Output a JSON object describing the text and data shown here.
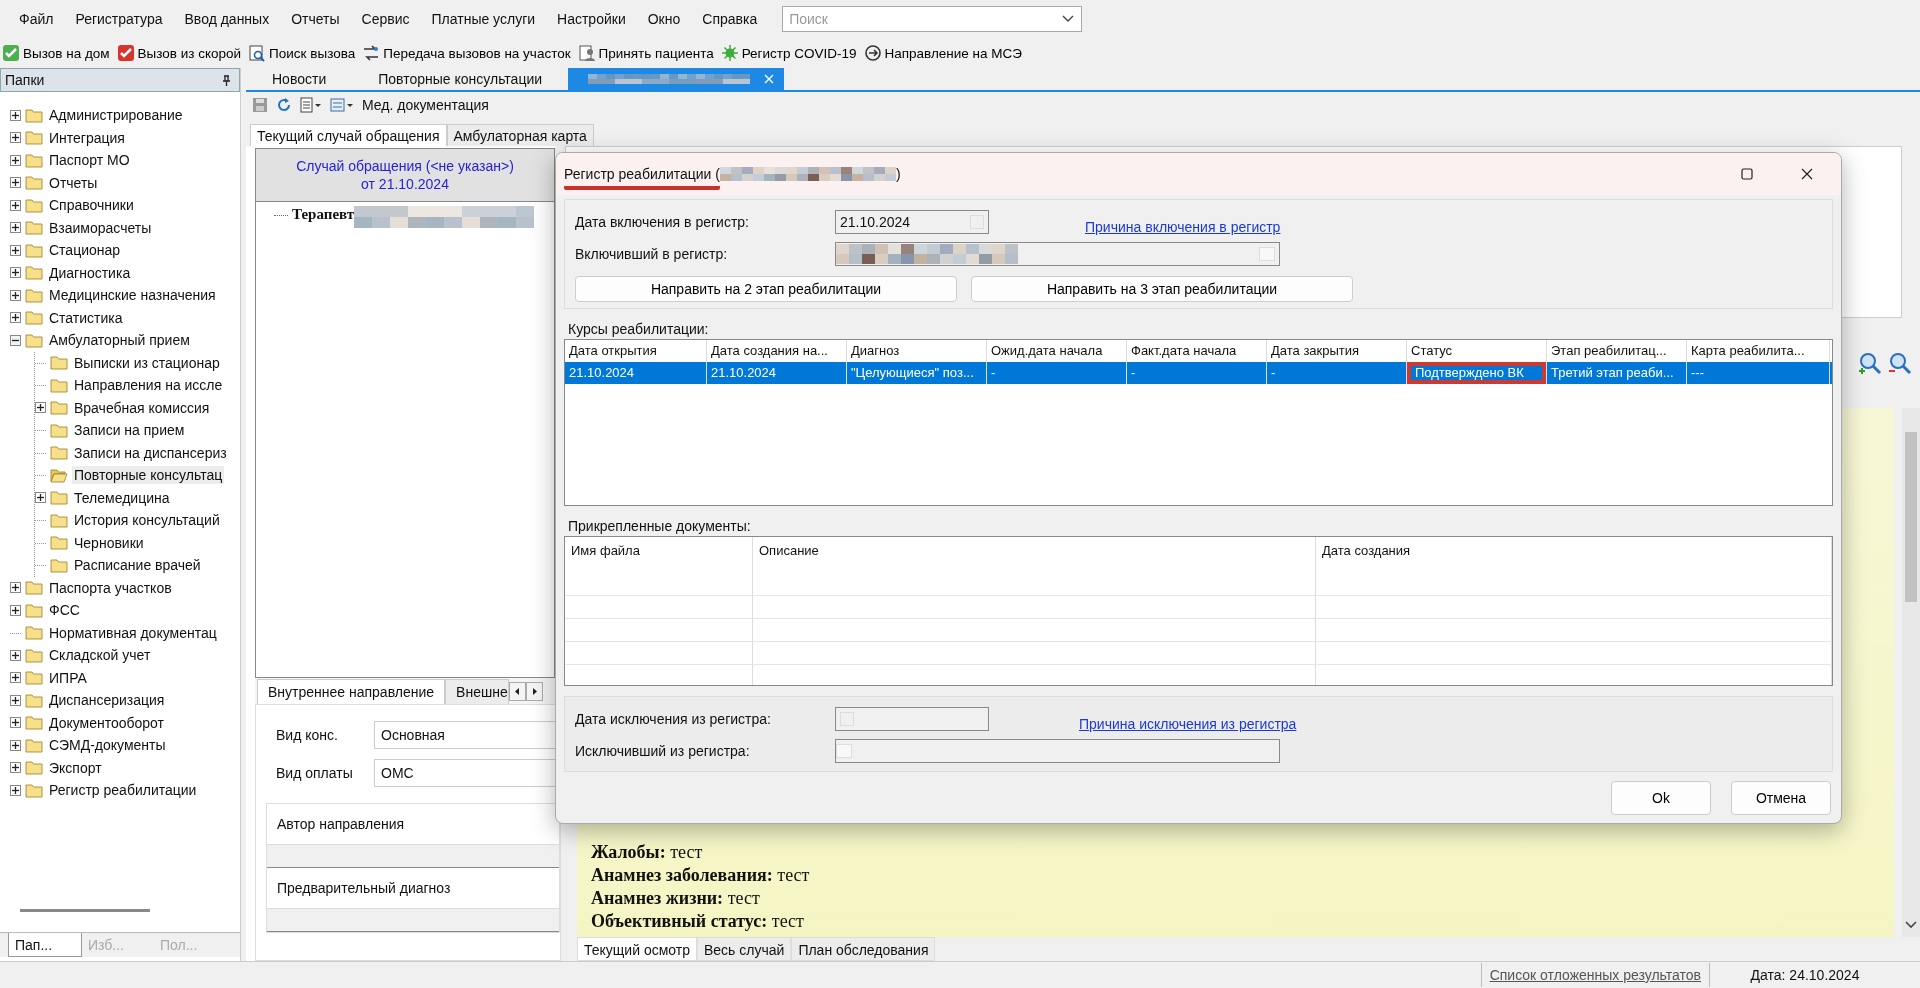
{
  "menu": [
    "Файл",
    "Регистратура",
    "Ввод данных",
    "Отчеты",
    "Сервис",
    "Платные услуги",
    "Настройки",
    "Окно",
    "Справка"
  ],
  "search": {
    "placeholder": "Поиск"
  },
  "toolbar": [
    {
      "label": "Вызов на дом"
    },
    {
      "label": "Вызов из скорой"
    },
    {
      "label": "Поиск вызова"
    },
    {
      "label": "Передача вызовов на участок"
    },
    {
      "label": "Принять пациента"
    },
    {
      "label": "Регистр COVID-19"
    },
    {
      "label": "Направление на МСЭ"
    }
  ],
  "folders_panel": {
    "title": "Папки",
    "tree": [
      {
        "label": "Администрирование",
        "expandable": true,
        "expanded": false,
        "selected": false
      },
      {
        "label": "Интеграция",
        "expandable": true,
        "expanded": false,
        "selected": false
      },
      {
        "label": "Паспорт МО",
        "expandable": true,
        "expanded": false,
        "selected": false
      },
      {
        "label": "Отчеты",
        "expandable": true,
        "expanded": false,
        "selected": false
      },
      {
        "label": "Справочники",
        "expandable": true,
        "expanded": false,
        "selected": false
      },
      {
        "label": "Взаиморасчеты",
        "expandable": true,
        "expanded": false,
        "selected": false
      },
      {
        "label": "Стационар",
        "expandable": true,
        "expanded": false,
        "selected": false
      },
      {
        "label": "Диагностика",
        "expandable": true,
        "expanded": false,
        "selected": false
      },
      {
        "label": "Медицинские назначения",
        "expandable": true,
        "expanded": false,
        "selected": false
      },
      {
        "label": "Статистика",
        "expandable": true,
        "expanded": false,
        "selected": false
      },
      {
        "label": "Амбулаторный прием",
        "expandable": true,
        "expanded": true,
        "selected": false,
        "children": [
          {
            "label": "Выписки из стационар",
            "expandable": false,
            "selected": false
          },
          {
            "label": "Направления на иссле",
            "expandable": false,
            "selected": false
          },
          {
            "label": "Врачебная комиссия",
            "expandable": true,
            "expanded": false,
            "selected": false
          },
          {
            "label": "Записи на прием",
            "expandable": false,
            "selected": false
          },
          {
            "label": "Записи на диспансериз",
            "expandable": false,
            "selected": false
          },
          {
            "label": "Повторные консультац",
            "expandable": false,
            "selected": true
          },
          {
            "label": "Телемедицина",
            "expandable": true,
            "expanded": false,
            "selected": false
          },
          {
            "label": "История консультаций",
            "expandable": false,
            "selected": false
          },
          {
            "label": "Черновики",
            "expandable": false,
            "selected": false
          },
          {
            "label": "Расписание врачей",
            "expandable": false,
            "selected": false
          }
        ]
      },
      {
        "label": "Паспорта участков",
        "expandable": true,
        "expanded": false,
        "selected": false
      },
      {
        "label": "ФСС",
        "expandable": true,
        "expanded": false,
        "selected": false
      },
      {
        "label": "Нормативная документац",
        "expandable": false,
        "selected": false
      },
      {
        "label": "Складской учет",
        "expandable": true,
        "expanded": false,
        "selected": false
      },
      {
        "label": "ИПРА",
        "expandable": true,
        "expanded": false,
        "selected": false
      },
      {
        "label": "Диспансеризация",
        "expandable": true,
        "expanded": false,
        "selected": false
      },
      {
        "label": "Документооборот",
        "expandable": true,
        "expanded": false,
        "selected": false
      },
      {
        "label": "СЭМД-документы",
        "expandable": true,
        "expanded": false,
        "selected": false
      },
      {
        "label": "Экспорт",
        "expandable": true,
        "expanded": false,
        "selected": false
      },
      {
        "label": "Регистр реабилитации",
        "expandable": true,
        "expanded": false,
        "selected": false
      }
    ],
    "tabs": [
      {
        "label": "Пап...",
        "selected": true
      },
      {
        "label": "Изб...",
        "selected": false
      },
      {
        "label": "Пол...",
        "selected": false
      }
    ]
  },
  "doc_tabs": [
    {
      "kind": "text",
      "label": "Новости",
      "selected": false
    },
    {
      "kind": "text",
      "label": "Повторные консультации",
      "selected": false
    },
    {
      "kind": "redacted",
      "selected": true
    }
  ],
  "doc_toolbar": {
    "label": "Мед. документация"
  },
  "case_tabs": [
    {
      "label": "Текущий случай обращения",
      "selected": true
    },
    {
      "label": "Амбулаторная карта",
      "selected": false
    }
  ],
  "case": {
    "header_line1": "Случай обращения (<не указан>)",
    "header_line2": "от 21.10.2024",
    "tree_item": "Терапевт"
  },
  "referral": {
    "tabs": [
      {
        "label": "Внутреннее направление",
        "selected": true
      },
      {
        "label": "Внешне",
        "selected": false
      }
    ],
    "fields": [
      {
        "label": "Вид конс.",
        "value": "Основная"
      },
      {
        "label": "Вид оплаты",
        "value": "ОМС"
      }
    ],
    "sections": [
      "Автор направления",
      "Предварительный диагноз"
    ]
  },
  "exam": {
    "lines": [
      "**Жалобы:** тест",
      "**Анамнез заболевания:** тест",
      "**Анамнез жизни:** тест",
      "**Объективный статус:** тест"
    ],
    "tabs": [
      {
        "label": "Текущий осмотр",
        "selected": true
      },
      {
        "label": "Весь случай",
        "selected": false
      },
      {
        "label": "План обследования",
        "selected": false
      }
    ]
  },
  "dialog": {
    "title_prefix": "Регистр реабилитации (",
    "title_suffix": ")",
    "title_underlined": true,
    "inclusion": {
      "date_label": "Дата включения в регистр:",
      "date": "21.10.2024",
      "reason_link": "Причина включения в регистр",
      "by_label": "Включивший в регистр:"
    },
    "actions": [
      "Направить на 2 этап реабилитации",
      "Направить на 3 этап реабилитации"
    ],
    "courses": {
      "label": "Курсы реабилитации:",
      "columns": [
        "Дата открытия",
        "Дата создания на...",
        "Диагноз",
        "Ожид.дата начала",
        "Факт.дата начала",
        "Дата закрытия",
        "Статус",
        "Этап  реабилитац...",
        "Карта  реабилита..."
      ],
      "rows": [
        {
          "selected": true,
          "cells": [
            {
              "text": "21.10.2024",
              "highlighted": false
            },
            {
              "text": "21.10.2024",
              "highlighted": false
            },
            {
              "text": "\"Целующиеся\"  поз...",
              "highlighted": false
            },
            {
              "text": "-",
              "highlighted": false
            },
            {
              "text": "-",
              "highlighted": false
            },
            {
              "text": "-",
              "highlighted": false
            },
            {
              "text": "Подтверждено ВК",
              "highlighted": true
            },
            {
              "text": "Третий этап реаби...",
              "highlighted": false
            },
            {
              "text": "---",
              "highlighted": false
            }
          ]
        }
      ]
    },
    "documents": {
      "label": "Прикрепленные документы:",
      "columns": [
        "Имя файла",
        "Описание",
        "Дата создания"
      ]
    },
    "exclusion": {
      "date_label": "Дата исключения из регистра:",
      "reason_link": "Причина исключения из регистра",
      "by_label": "Исключивший из регистра:"
    },
    "buttons": [
      "Ok",
      "Отмена"
    ]
  },
  "status_bar": {
    "link": "Список отложенных результатов",
    "date": "Дата: 24.10.2024"
  }
}
